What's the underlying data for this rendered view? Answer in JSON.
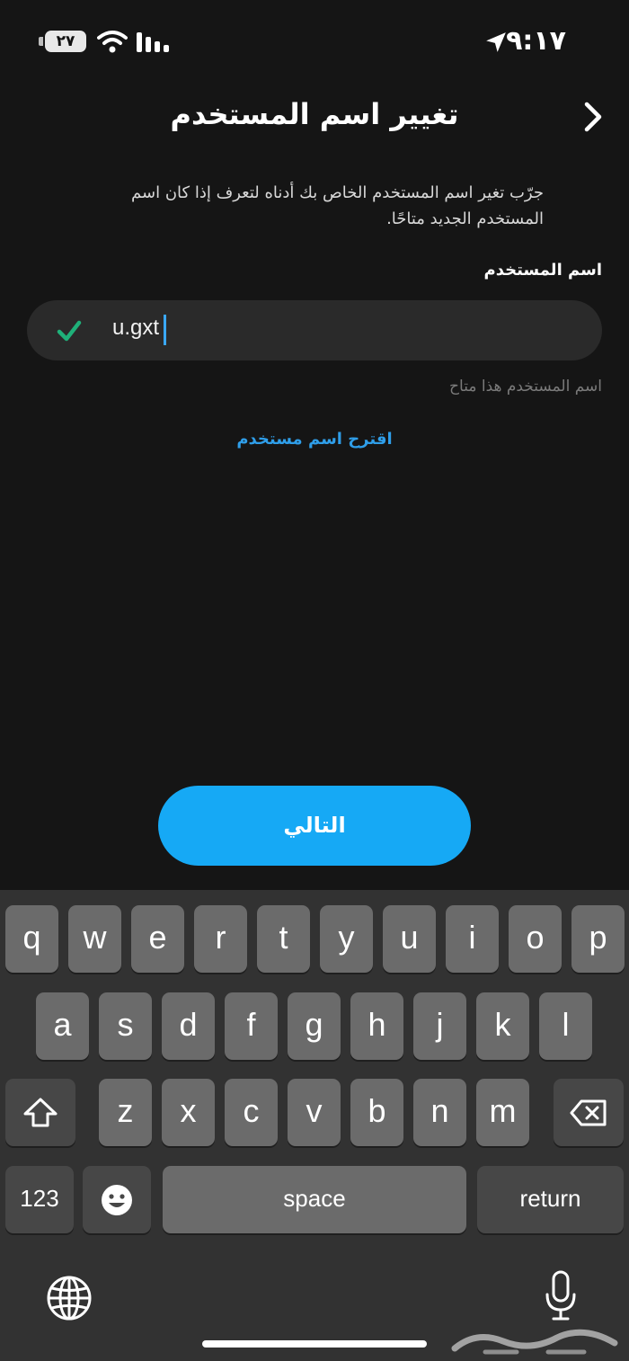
{
  "status_bar": {
    "time": "٩:١٧",
    "battery": "٢٧",
    "icons": [
      "location-arrow-icon",
      "wifi-icon",
      "cellular-signal-icon",
      "battery-icon"
    ]
  },
  "header": {
    "title": "تغيير اسم المستخدم",
    "back_icon": "chevron-right-icon"
  },
  "description": "جرّب تغير اسم المستخدم الخاص بك أدناه لتعرف إذا كان اسم المستخدم الجديد متاحًا.",
  "username_field": {
    "label": "اسم المستخدم",
    "value": "u.gxt",
    "valid_icon": "checkmark-icon"
  },
  "availability_message": "اسم المستخدم هذا متاح",
  "suggest_link": "اقترح اسم مستخدم",
  "next_button": "التالي",
  "keyboard": {
    "row1": [
      "q",
      "w",
      "e",
      "r",
      "t",
      "y",
      "u",
      "i",
      "o",
      "p"
    ],
    "row2": [
      "a",
      "s",
      "d",
      "f",
      "g",
      "h",
      "j",
      "k",
      "l"
    ],
    "row3": [
      "z",
      "x",
      "c",
      "v",
      "b",
      "n",
      "m"
    ],
    "numbers_key": "123",
    "space_key": "space",
    "return_key": "return",
    "icons": [
      "shift-icon",
      "backspace-icon",
      "emoji-icon",
      "globe-icon",
      "microphone-icon"
    ]
  },
  "colors": {
    "accent": "#16a9f5",
    "link": "#2f9ee9",
    "valid_check": "#1fb079",
    "background": "#151515"
  }
}
